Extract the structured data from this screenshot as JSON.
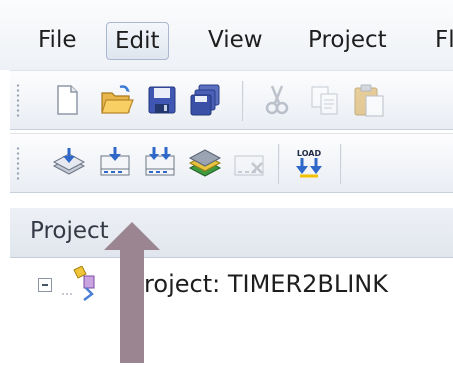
{
  "menu": {
    "items": [
      {
        "label": "File",
        "active": false
      },
      {
        "label": "Edit",
        "active": true
      },
      {
        "label": "View",
        "active": false
      },
      {
        "label": "Project",
        "active": false
      },
      {
        "label": "Fl",
        "active": false
      }
    ]
  },
  "toolbar_standard": {
    "icons": [
      "new-file-icon",
      "open-folder-icon",
      "save-icon",
      "save-all-icon",
      "cut-icon",
      "copy-icon",
      "paste-icon"
    ]
  },
  "toolbar_build": {
    "icons": [
      "translate-icon",
      "build-icon",
      "rebuild-icon",
      "batch-build-icon",
      "stop-build-icon",
      "load-download-icon"
    ],
    "load_label": "LOAD"
  },
  "project_panel": {
    "title": "Project",
    "tree": [
      {
        "label": "Project: TIMER2BLINK",
        "expanded": true
      }
    ]
  },
  "colors": {
    "arrow": "#9a8590",
    "menu_active_border": "#a9b8cf",
    "panel_header": "#e6eaf1"
  }
}
